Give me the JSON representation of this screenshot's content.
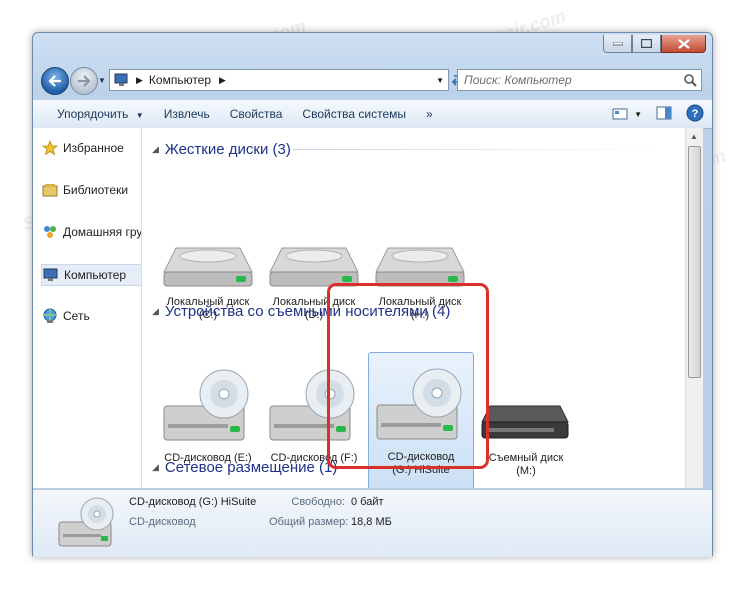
{
  "address": {
    "crumb": "Компьютер"
  },
  "search": {
    "placeholder": "Поиск: Компьютер"
  },
  "toolbar": {
    "organize": "Упорядочить",
    "eject": "Извлечь",
    "properties": "Свойства",
    "system_properties": "Свойства системы",
    "more": "»"
  },
  "nav": [
    {
      "label": "Избранное",
      "icon": "star-icon"
    },
    {
      "label": "Библиотеки",
      "icon": "library-icon"
    },
    {
      "label": "Домашняя группа",
      "icon": "homegroup-icon"
    },
    {
      "label": "Компьютер",
      "icon": "computer-icon"
    },
    {
      "label": "Сеть",
      "icon": "network-icon"
    }
  ],
  "groups": {
    "hard_disks": "Жесткие диски (3)",
    "removable": "Устройства со съемными носителями (4)",
    "network": "Сетевое размещение (1)"
  },
  "hard_disks": [
    {
      "line1": "Локальный диск",
      "line2": "(C:)"
    },
    {
      "line1": "Локальный диск",
      "line2": "(D:)"
    },
    {
      "line1": "Локальный диск",
      "line2": "(H:)"
    }
  ],
  "removable": [
    {
      "line1": "CD-дисковод (E:)",
      "line2": ""
    },
    {
      "line1": "CD-дисковод (F:)",
      "line2": ""
    },
    {
      "line1": "CD-дисковод",
      "line2": "(G:) HiSuite"
    },
    {
      "line1": "Съемный диск",
      "line2": "(M:)"
    }
  ],
  "details": {
    "name": "CD-дисковод (G:) HiSuite",
    "type": "CD-дисковод",
    "free_label": "Свободно:",
    "free_value": "0 байт",
    "total_label": "Общий размер:",
    "total_value": "18,8 МБ"
  },
  "watermark": "Soringpcrepair.com",
  "colors": {
    "accent": "#1e3287",
    "highlight": "#d9302c"
  }
}
